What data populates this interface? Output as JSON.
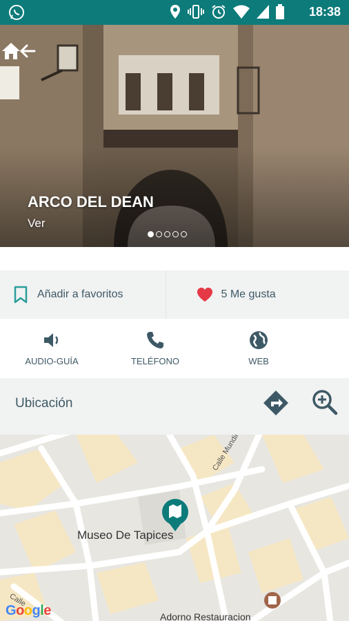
{
  "status_bar": {
    "time": "18:38"
  },
  "hero": {
    "title": "ARCO DEL DEAN",
    "subtitle": "Ver",
    "slide_count": 5,
    "active_slide": 1
  },
  "actions": {
    "favorite_label": "Añadir a favoritos",
    "likes_label": "5 Me gusta"
  },
  "contact": {
    "audio_label": "AUDIO-GUÍA",
    "phone_label": "TELÉFONO",
    "web_label": "WEB"
  },
  "location": {
    "label": "Ubicación"
  },
  "map": {
    "poi_label": "Museo De Tapices",
    "street_1": "Calle Mundir I",
    "street_2": "Calle",
    "restaurant_label": "Adorno Restauracion",
    "attribution": "Google"
  },
  "colors": {
    "status_bar": "#0c7b7a",
    "accent_teal": "#2a9d9a",
    "heart_red": "#e53946",
    "text_slate": "#3e5966"
  }
}
